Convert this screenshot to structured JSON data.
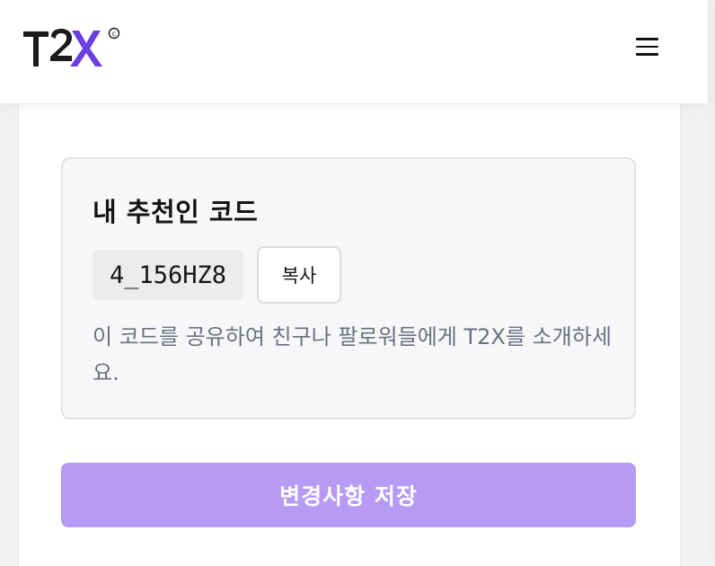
{
  "header": {
    "logo_text": "T2X",
    "logo_mark": "©",
    "menu_icon": "hamburger-menu-icon"
  },
  "referral": {
    "title": "내 추천인 코드",
    "code": "4_156HZ8",
    "copy_label": "복사",
    "description": "이 코드를 공유하여 친구나 팔로워들에게 T2X를 소개하세요."
  },
  "actions": {
    "save_label": "변경사항 저장"
  },
  "colors": {
    "accent": "#b69af3",
    "logo_x": "#6a3fe0",
    "text": "#151515",
    "muted": "#6b7180"
  }
}
